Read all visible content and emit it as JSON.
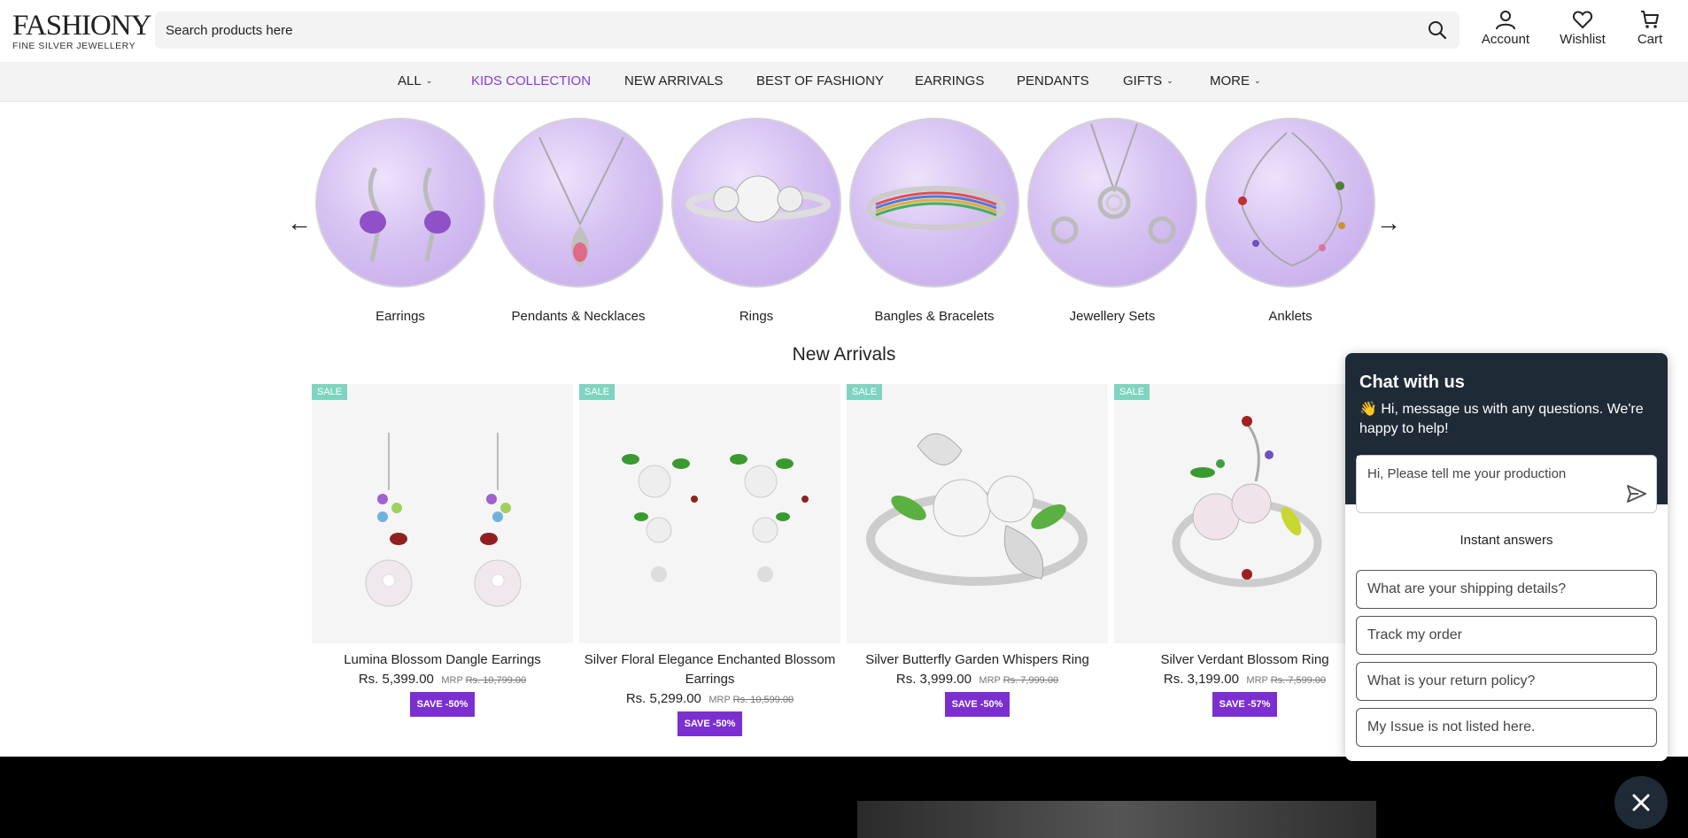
{
  "header": {
    "logo_main": "FASHIONY",
    "logo_sub": "FINE SILVER JEWELLERY",
    "search_placeholder": "Search products here",
    "account_label": "Account",
    "wishlist_label": "Wishlist",
    "cart_label": "Cart"
  },
  "nav": {
    "items": [
      {
        "label": "ALL",
        "has_caret": true
      },
      {
        "label": "KIDS COLLECTION",
        "has_caret": false,
        "active": true
      },
      {
        "label": "NEW ARRIVALS",
        "has_caret": false
      },
      {
        "label": "BEST OF FASHIONY",
        "has_caret": false
      },
      {
        "label": "EARRINGS",
        "has_caret": false
      },
      {
        "label": "PENDANTS",
        "has_caret": false
      },
      {
        "label": "GIFTS",
        "has_caret": true
      },
      {
        "label": "MORE",
        "has_caret": true
      }
    ],
    "active_color": "#8a3cd6"
  },
  "categories": {
    "prev_arrow": "←",
    "next_arrow": "→",
    "items": [
      {
        "label": "Earrings",
        "icon": "earrings-image"
      },
      {
        "label": "Pendants & Necklaces",
        "icon": "pendant-image"
      },
      {
        "label": "Rings",
        "icon": "ring-image"
      },
      {
        "label": "Bangles & Bracelets",
        "icon": "bangle-image"
      },
      {
        "label": "Jewellery Sets",
        "icon": "jewellery-set-image"
      },
      {
        "label": "Anklets",
        "icon": "anklet-image"
      }
    ]
  },
  "new_arrivals": {
    "title": "New Arrivals",
    "products": [
      {
        "badge": "SALE",
        "name": "Lumina Blossom Dangle Earrings",
        "price": "Rs. 5,399.00",
        "mrp_label": "MRP",
        "mrp": "Rs. 10,799.00",
        "save": "SAVE -50%"
      },
      {
        "badge": "SALE",
        "name": "Silver Floral Elegance Enchanted Blossom Earrings",
        "price": "Rs. 5,299.00",
        "mrp_label": "MRP",
        "mrp": "Rs. 10,599.00",
        "save": "SAVE -50%"
      },
      {
        "badge": "SALE",
        "name": "Silver Butterfly Garden Whispers Ring",
        "price": "Rs. 3,999.00",
        "mrp_label": "MRP",
        "mrp": "Rs. 7,999.00",
        "save": "SAVE -50%"
      },
      {
        "badge": "SALE",
        "name": "Silver Verdant Blossom Ring",
        "price": "Rs. 3,199.00",
        "mrp_label": "MRP",
        "mrp": "Rs. 7,599.00",
        "save": "SAVE -57%"
      }
    ],
    "badge_color": "#7fd4c1",
    "save_color": "#7c2fd0"
  },
  "chat": {
    "title": "Chat with us",
    "subtitle": "👋 Hi, message us with any questions. We're happy to help!",
    "input_placeholder": "Hi, Please tell me your production",
    "instant_answers_label": "Instant answers",
    "questions": [
      "What are your shipping details?",
      "Track my order",
      "What is your return policy?",
      "My Issue is not listed here."
    ],
    "header_color": "#1f2a37"
  }
}
